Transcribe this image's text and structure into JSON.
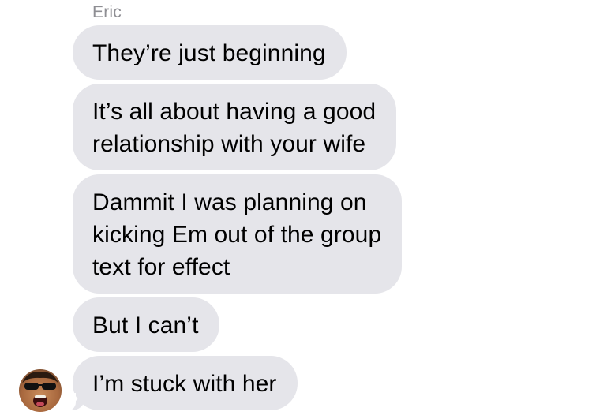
{
  "thread": {
    "sender_name": "Eric",
    "messages": [
      {
        "text": "They’re just beginning"
      },
      {
        "text": "It’s all about having a good\nrelationship with your wife"
      },
      {
        "text": "Dammit I was planning on\nkicking Em out of the group\ntext for effect"
      },
      {
        "text": "But I can’t"
      },
      {
        "text": "I’m stuck with her"
      }
    ],
    "avatar_icon": "person-avatar-icon",
    "bubble_color": "#e5e5ea",
    "sender_label_color": "#8e8e93"
  }
}
